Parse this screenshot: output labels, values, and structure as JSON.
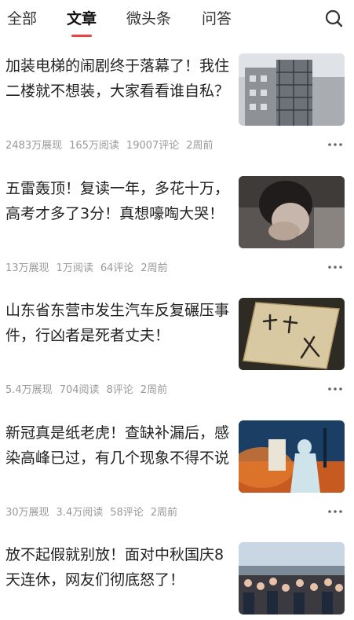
{
  "tabs": [
    {
      "label": "全部",
      "active": false
    },
    {
      "label": "文章",
      "active": true
    },
    {
      "label": "微头条",
      "active": false
    },
    {
      "label": "问答",
      "active": false
    }
  ],
  "search_icon": "search-icon",
  "more_icon": "more-icon",
  "accent_color": "#f04142",
  "articles": [
    {
      "title": "加装电梯的闹剧终于落幕了！我住二楼就不想装，大家看看谁自私？",
      "impressions": "2483万展现",
      "reads": "165万阅读",
      "comments": "19007评论",
      "time": "2周前"
    },
    {
      "title": "五雷轰顶！复读一年，多花十万，高考才多了3分！真想嚎啕大哭！",
      "impressions": "13万展现",
      "reads": "1万阅读",
      "comments": "64评论",
      "time": "2周前"
    },
    {
      "title": "山东省东营市发生汽车反复碾压事件，行凶者是死者丈夫！",
      "impressions": "5.4万展现",
      "reads": "704阅读",
      "comments": "8评论",
      "time": "2周前"
    },
    {
      "title": "新冠真是纸老虎！查缺补漏后，感染高峰已过，有几个现象不得不说",
      "impressions": "30万展现",
      "reads": "3.4万阅读",
      "comments": "58评论",
      "time": "2周前"
    },
    {
      "title": "放不起假就别放！面对中秋国庆8天连休，网友们彻底怒了！"
    }
  ]
}
